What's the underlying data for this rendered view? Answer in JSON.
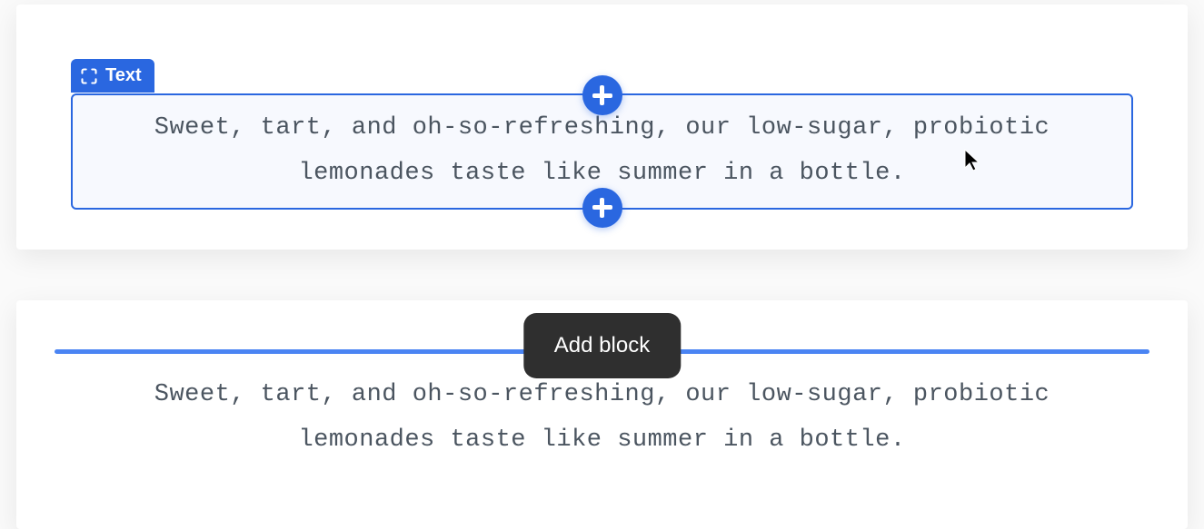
{
  "block1": {
    "label": "Text",
    "content": "Sweet, tart, and oh-so-refreshing, our low-sugar, probiotic lemonades taste like summer in a bottle."
  },
  "block2": {
    "content": "Sweet, tart, and oh-so-refreshing, our low-sugar, probiotic lemonades taste like summer in a bottle."
  },
  "tooltip": {
    "label": "Add block"
  }
}
